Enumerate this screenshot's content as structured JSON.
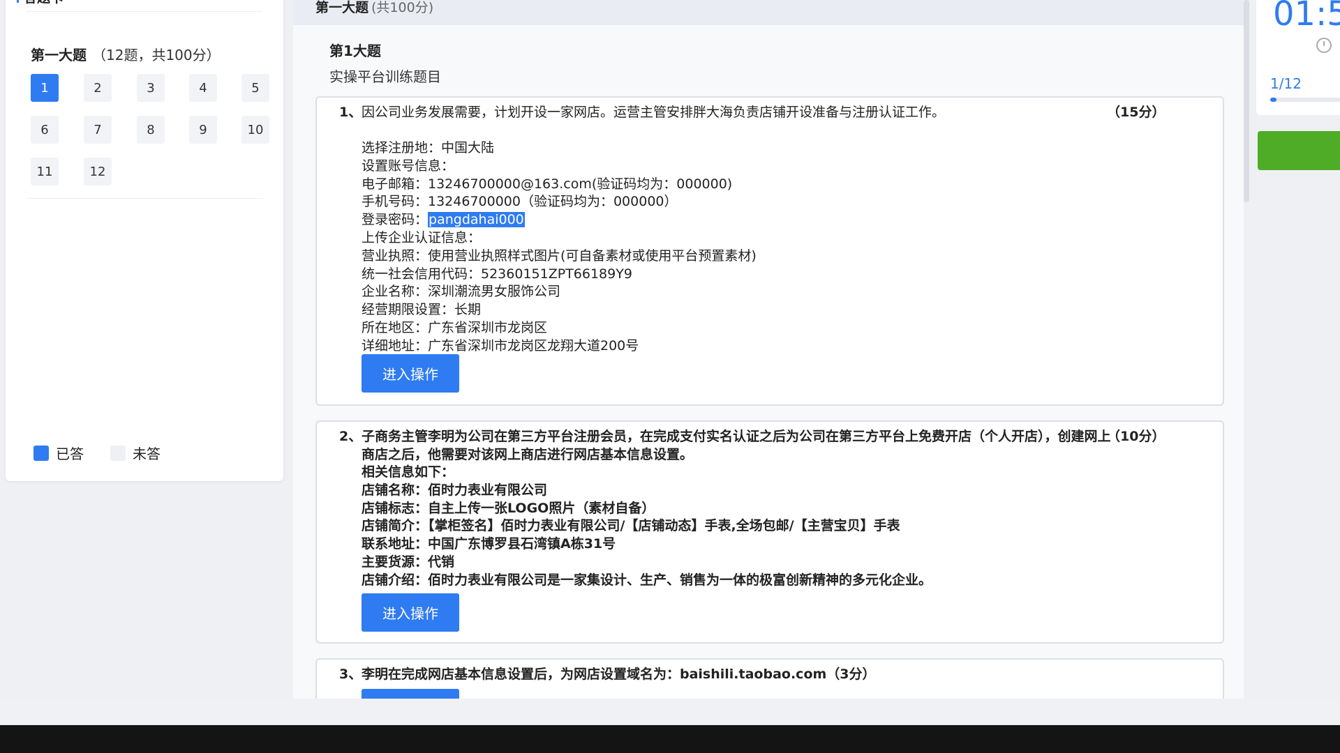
{
  "sidebar": {
    "title": "答题卡",
    "section_name": "第一大题",
    "section_meta": "（12题，共100分）",
    "questions": [
      "1",
      "2",
      "3",
      "4",
      "5",
      "6",
      "7",
      "8",
      "9",
      "10",
      "11",
      "12"
    ],
    "current": "1",
    "legend_done": "已答",
    "legend_todo": "未答"
  },
  "header": {
    "section_name": "第一大题",
    "section_meta": "(共100分)"
  },
  "part": {
    "title": "第1大题",
    "subtitle": "实操平台训练题目"
  },
  "q1": {
    "num": "1、",
    "text": "因公司业务发展需要，计划开设一家网店。运营主管安排胖大海负责店铺开设准备与注册认证工作。",
    "score": "（15分）",
    "lines": {
      "l1": "选择注册地：中国大陆",
      "l2": "设置账号信息：",
      "l3": "电子邮箱：13246700000@163.com(验证码均为：000000)",
      "l4": "手机号码：13246700000（验证码均为：000000）",
      "l5_label": "登录密码：",
      "l5_value": "pangdahai000",
      "l6": "上传企业认证信息：",
      "l7": "营业执照：使用营业执照样式图片(可自备素材或使用平台预置素材)",
      "l8": "统一社会信用代码：52360151ZPT66189Y9",
      "l9": "企业名称：深圳潮流男女服饰公司",
      "l10": "经营期限设置：长期",
      "l11": "所在地区：广东省深圳市龙岗区",
      "l12": "详细地址：广东省深圳市龙岗区龙翔大道200号"
    },
    "button": "进入操作"
  },
  "q2": {
    "num": "2、",
    "text": "子商务主管李明为公司在第三方平台注册会员，在完成支付实名认证之后为公司在第三方平台上免费开店（个人开店），创建网上商店之后，他需要对该网上商店进行网店基本信息设置。",
    "score": "（10分）",
    "lines": {
      "l1": "相关信息如下：",
      "l2": "店铺名称：佰时力表业有限公司",
      "l3": "店铺标志：自主上传一张LOGO照片（素材自备）",
      "l4": "店铺简介：【掌柜签名】佰时力表业有限公司/【店铺动态】手表,全场包邮/【主营宝贝】手表",
      "l5": "联系地址：中国广东博罗县石湾镇A栋31号",
      "l6": "主要货源：代销",
      "l7": "店铺介绍：佰时力表业有限公司是一家集设计、生产、销售为一体的极富创新精神的多元化企业。"
    },
    "button": "进入操作"
  },
  "q3": {
    "num": "3、",
    "text": "李明在完成网店基本信息设置后，为网店设置域名为：baishili.taobao.com（3分）"
  },
  "timer": {
    "value": "01:5",
    "progress_text": "1/12",
    "progress_fraction": 0.083
  },
  "colors": {
    "accent": "#2f7bf2",
    "submit": "#4fac26"
  }
}
